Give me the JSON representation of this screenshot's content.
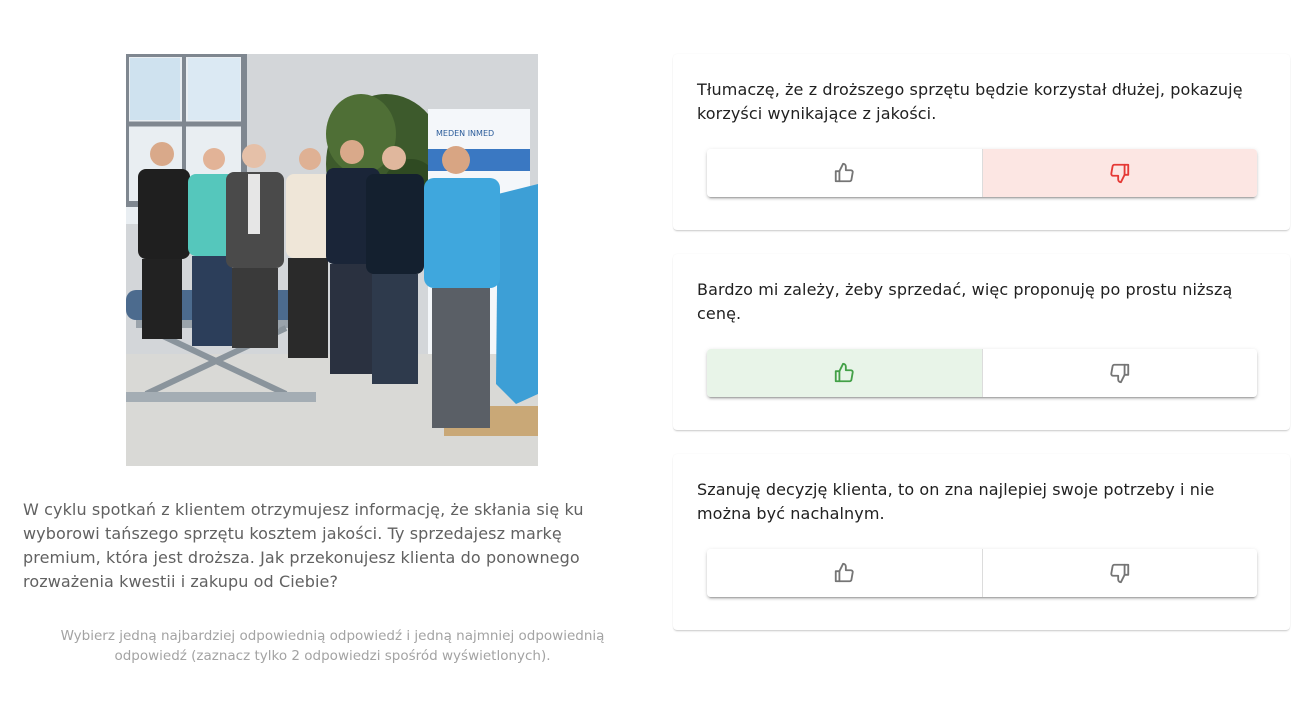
{
  "question": {
    "text": "W cyklu spotkań z klientem otrzymujesz informację, że skłania się ku wyborowi tańszego sprzętu kosztem jakości. Ty sprzedajesz markę premium, która jest droższa. Jak przekonujesz klienta do ponownego rozważenia kwestii i zakupu od Ciebie?",
    "instruction": "Wybierz jedną najbardziej odpowiednią odpowiedź i jedną najmniej odpowiednią odpowiedź (zaznacz tylko 2 odpowiedzi spośród wyświetlonych)."
  },
  "photo": {
    "banner_text": "MEDEN INMED"
  },
  "answers": [
    {
      "text": "Tłumaczę, że z droższego sprzętu będzie korzystał dłużej, pokazuję korzyści wynikające z jakości.",
      "selection": "dislike",
      "like_icon": "thumb-up-icon",
      "dislike_icon": "thumb-down-icon"
    },
    {
      "text": "Bardzo mi zależy, żeby sprzedać, więc proponuję po prostu niższą cenę.",
      "selection": "like",
      "like_icon": "thumb-up-icon",
      "dislike_icon": "thumb-down-icon"
    },
    {
      "text": "Szanuję decyzję klienta, to on zna najlepiej swoje potrzeby i nie można być nachalnym.",
      "selection": "none",
      "like_icon": "thumb-up-icon",
      "dislike_icon": "thumb-down-icon"
    }
  ],
  "colors": {
    "like_active_bg": "#e8f4e8",
    "like_active_fg": "#43a047",
    "dislike_active_bg": "#fce6e3",
    "dislike_active_fg": "#e53935",
    "question_text": "#616161",
    "instruction_text": "#a3a3a3"
  }
}
